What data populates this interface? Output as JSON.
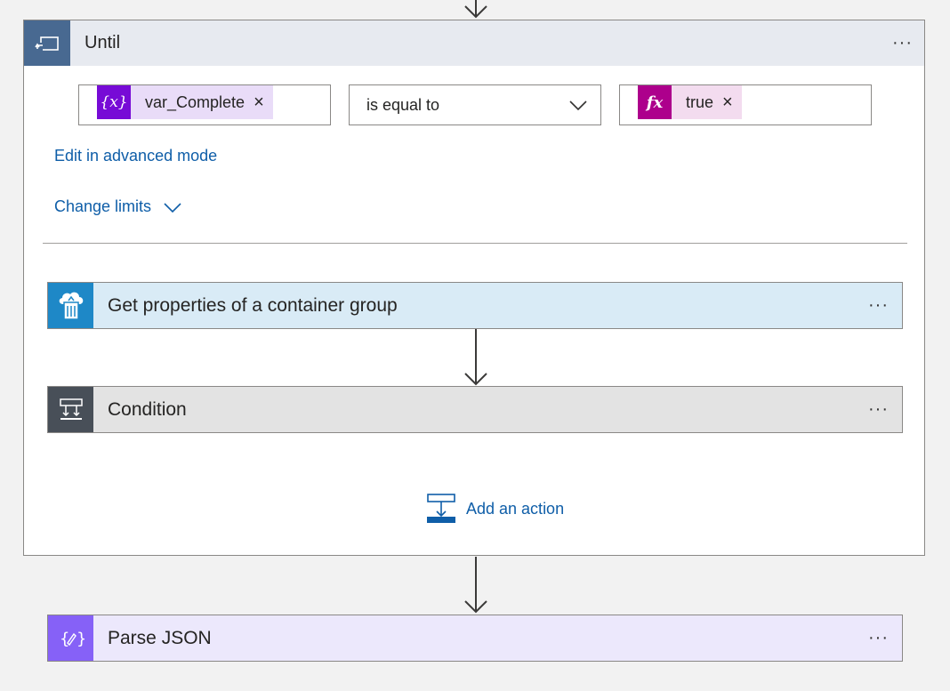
{
  "until": {
    "title": "Until",
    "more_label": "···",
    "condition": {
      "left_token": "var_Complete",
      "left_token_icon": "{x}",
      "operator": "is equal to",
      "right_token": "true",
      "right_token_icon": "fx",
      "remove_label": "×"
    },
    "advanced_link": "Edit in advanced mode",
    "limits_link": "Change limits",
    "add_action_label": "Add an action"
  },
  "actions": [
    {
      "title": "Get properties of a container group",
      "more_label": "···",
      "icon": "container-instance-icon",
      "header_color": "#d9ebf6",
      "icon_color": "#1e88c7"
    },
    {
      "title": "Condition",
      "more_label": "···",
      "icon": "condition-icon",
      "header_color": "#e3e3e3",
      "icon_color": "#484f58"
    }
  ],
  "after": {
    "title": "Parse JSON",
    "more_label": "···",
    "icon": "parse-json-icon",
    "header_color": "#ece8fc",
    "icon_color": "#8661f7"
  },
  "colors": {
    "variable_token": "#770bd6",
    "variable_token_bg": "#e9dcf8",
    "expression_token": "#ad008c",
    "expression_token_bg": "#f3dcef",
    "link": "#0f5ea8",
    "until_header": "#486991"
  }
}
